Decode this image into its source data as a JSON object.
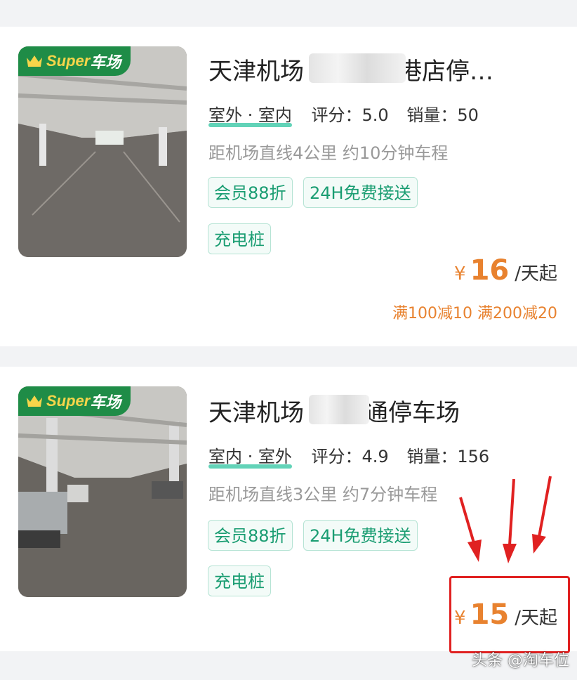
{
  "listings": [
    {
      "badge": {
        "brand": "Super",
        "label": "车场"
      },
      "title": "天津机场",
      "title_tail": "空港店停…",
      "types": "室外 · 室内",
      "rating_label": "评分：",
      "rating": "5.0",
      "sales_label": "销量：",
      "sales": "50",
      "distance": "距机场直线4公里 约10分钟车程",
      "tags": [
        "会员88折",
        "24H免费接送",
        "充电桩"
      ],
      "price_symbol": "¥",
      "price": "16",
      "price_unit": "/天起",
      "promo": "满100减10 满200减20"
    },
    {
      "badge": {
        "brand": "Super",
        "label": "车场"
      },
      "title": "天津机场",
      "title_tail": "通停车场",
      "types": "室内 · 室外",
      "rating_label": "评分：",
      "rating": "4.9",
      "sales_label": "销量：",
      "sales": "156",
      "distance": "距机场直线3公里 约7分钟车程",
      "tags": [
        "会员88折",
        "24H免费接送",
        "充电桩"
      ],
      "price_symbol": "¥",
      "price": "15",
      "price_unit": "/天起"
    }
  ],
  "watermark": "头条 @淘车位",
  "colors": {
    "brand_green": "#1f8c47",
    "price_orange": "#e8822f",
    "tag_green": "#1a9d72",
    "annotation_red": "#e02121"
  },
  "icons": {
    "badge": "crown-icon"
  }
}
